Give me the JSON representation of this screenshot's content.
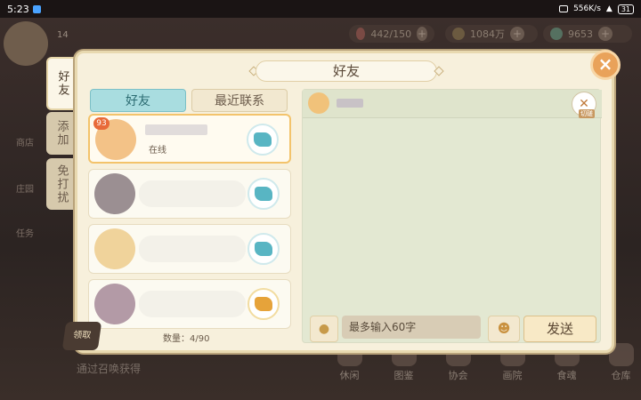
{
  "statusbar": {
    "time": "5:23",
    "net_speed": "556K/s",
    "battery": "31"
  },
  "background": {
    "level": "14",
    "stamina": "442/150",
    "coins": "1084万",
    "gems": "9653",
    "side_labels": [
      "商店",
      "庄园",
      "任务"
    ],
    "hint": "通过召唤获得",
    "nav": [
      "休闲",
      "图鉴",
      "协会",
      "画院",
      "食魂",
      "仓库"
    ]
  },
  "side_tabs": [
    "好友",
    "添加",
    "免打扰"
  ],
  "dialog": {
    "title": "好友",
    "close": "×",
    "tabs": {
      "friends": "好友",
      "recent": "最近联系"
    },
    "friends": [
      {
        "level": "93",
        "status": "在线"
      },
      {
        "level": "",
        "status": ""
      },
      {
        "level": "",
        "status": ""
      },
      {
        "level": "",
        "status": ""
      }
    ],
    "friend_count_label": "数量：4/90",
    "chat": {
      "tool_label": "切磋",
      "input_placeholder": "最多输入60字",
      "send": "发送"
    }
  },
  "corner_btn": "领取"
}
